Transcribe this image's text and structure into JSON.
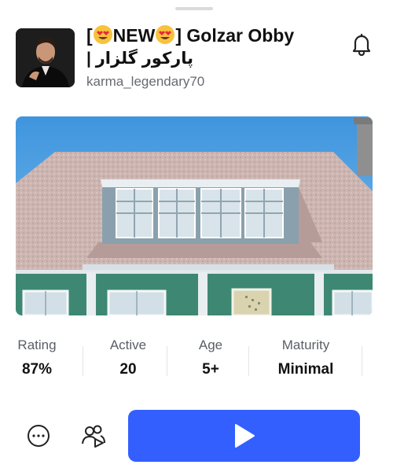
{
  "game": {
    "title_prefix": "[",
    "title_new": "NEW",
    "title_suffix": "] Golzar Obby",
    "subtitle": "| پارکور گلزار",
    "creator": "karma_legendary70"
  },
  "icons": {
    "notification": "bell-icon",
    "more": "more-horizontal-icon",
    "party": "party-icon",
    "play": "play-icon",
    "title_emoji": "heart-eyes-emoji"
  },
  "stats": [
    {
      "label": "Rating",
      "value": "87%"
    },
    {
      "label": "Active",
      "value": "20"
    },
    {
      "label": "Age",
      "value": "5+"
    },
    {
      "label": "Maturity",
      "value": "Minimal"
    }
  ],
  "colors": {
    "accent": "#335fff",
    "sky": "#4a9fe0",
    "roof": "#cfb6b2",
    "wall": "#3f8a78"
  }
}
